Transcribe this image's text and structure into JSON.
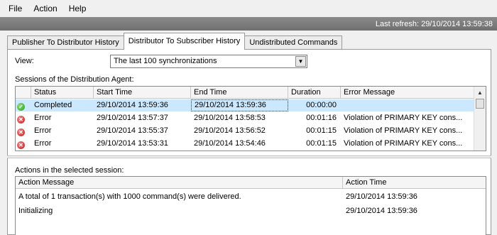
{
  "menu": {
    "file": "File",
    "action": "Action",
    "help": "Help"
  },
  "status": {
    "last_refresh": "Last refresh: 29/10/2014 13:59:38"
  },
  "tabs": [
    {
      "label": "Publisher To Distributor History"
    },
    {
      "label": "Distributor To Subscriber History"
    },
    {
      "label": "Undistributed Commands"
    }
  ],
  "view": {
    "label": "View:",
    "selected": "The last 100 synchronizations"
  },
  "sessions": {
    "title": "Sessions of the Distribution Agent:",
    "columns": [
      "Status",
      "Start Time",
      "End Time",
      "Duration",
      "Error Message"
    ],
    "rows": [
      {
        "status": "Completed",
        "start": "29/10/2014 13:59:36",
        "end": "29/10/2014 13:59:36",
        "duration": "00:00:00",
        "error": ""
      },
      {
        "status": "Error",
        "start": "29/10/2014 13:57:37",
        "end": "29/10/2014 13:58:53",
        "duration": "00:01:16",
        "error": "Violation of PRIMARY KEY cons..."
      },
      {
        "status": "Error",
        "start": "29/10/2014 13:55:37",
        "end": "29/10/2014 13:56:52",
        "duration": "00:01:15",
        "error": "Violation of PRIMARY KEY cons..."
      },
      {
        "status": "Error",
        "start": "29/10/2014 13:53:31",
        "end": "29/10/2014 13:54:46",
        "duration": "00:01:15",
        "error": "Violation of PRIMARY KEY cons..."
      }
    ]
  },
  "actions": {
    "title": "Actions in the selected session:",
    "columns": [
      "Action Message",
      "Action Time"
    ],
    "rows": [
      {
        "message": "A total of 1 transaction(s) with 1000 command(s) were delivered.",
        "time": "29/10/2014 13:59:36"
      },
      {
        "message": "Initializing",
        "time": "29/10/2014 13:59:36"
      }
    ]
  }
}
